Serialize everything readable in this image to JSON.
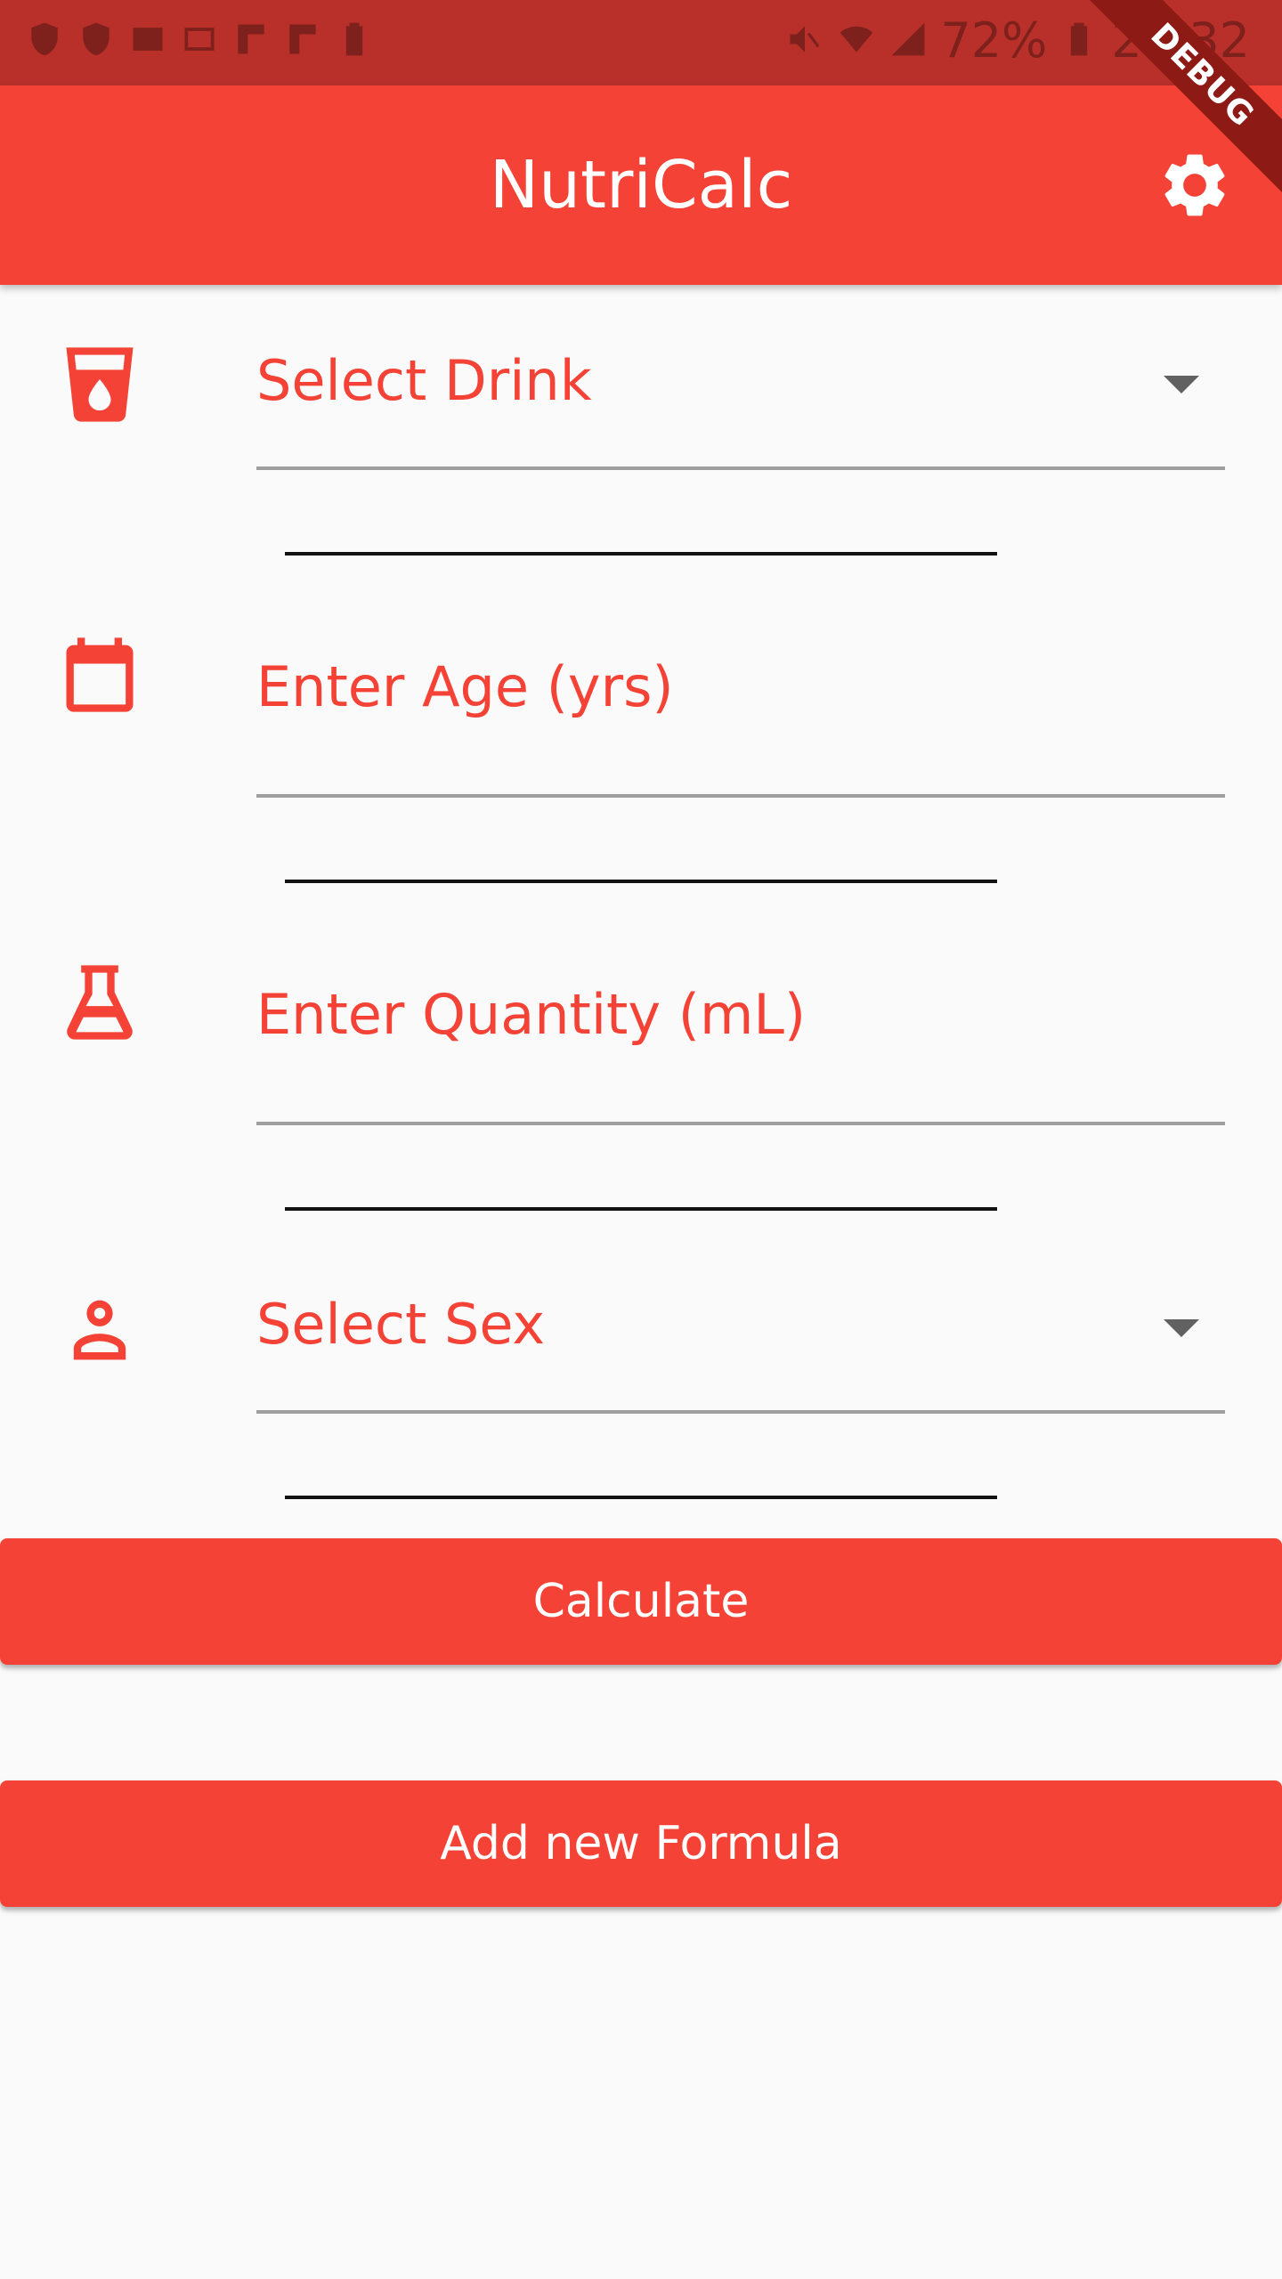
{
  "status_bar": {
    "battery": "72%",
    "time": "21:32"
  },
  "app_bar": {
    "title": "NutriCalc",
    "debug_banner": "DEBUG"
  },
  "form": {
    "drink": {
      "label": "Select Drink",
      "icon": "cup-icon"
    },
    "age": {
      "label": "Enter Age (yrs)",
      "icon": "calendar-icon"
    },
    "quantity": {
      "label": "Enter Quantity (mL)",
      "icon": "flask-icon"
    },
    "sex": {
      "label": "Select Sex",
      "icon": "person-icon"
    }
  },
  "buttons": {
    "calculate": "Calculate",
    "add_formula": "Add new Formula"
  },
  "colors": {
    "primary": "#f44336",
    "status_bar": "#b9302a",
    "background": "#fafafa"
  }
}
